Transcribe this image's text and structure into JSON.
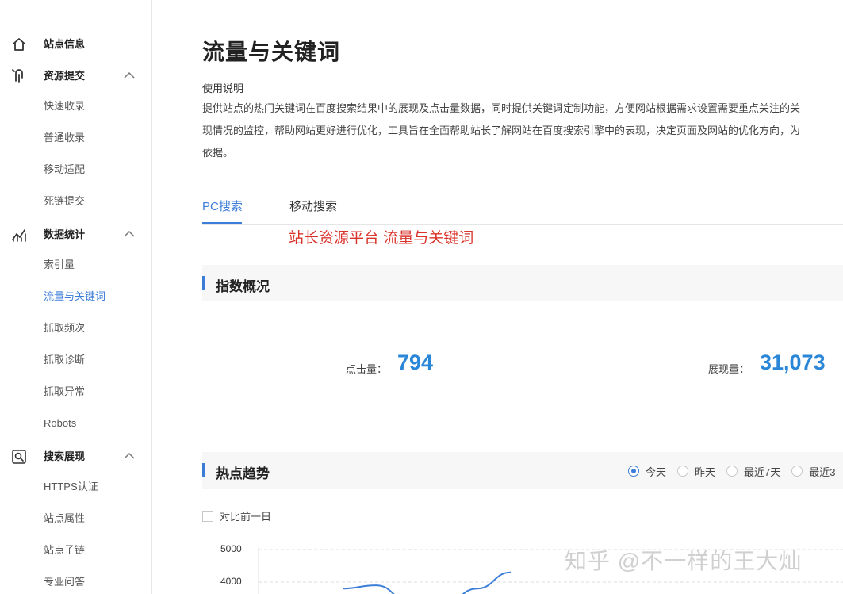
{
  "sidebar": {
    "groups": [
      {
        "label": "站点信息",
        "icon": "home-icon",
        "items": []
      },
      {
        "label": "资源提交",
        "icon": "submit-icon",
        "items": [
          "快速收录",
          "普通收录",
          "移动适配",
          "死链提交"
        ]
      },
      {
        "label": "数据统计",
        "icon": "stats-icon",
        "items": [
          "索引量",
          "流量与关键词",
          "抓取频次",
          "抓取诊断",
          "抓取异常",
          "Robots"
        ]
      },
      {
        "label": "搜索展现",
        "icon": "search-display-icon",
        "items": [
          "HTTPS认证",
          "站点属性",
          "站点子链",
          "专业问答"
        ]
      }
    ],
    "active_item": "流量与关键词"
  },
  "main": {
    "title": "流量与关键词",
    "usage": {
      "title": "使用说明",
      "lines": [
        "提供站点的热门关键词在百度搜索结果中的展现及点击量数据，同时提供关键词定制功能，方便网站根据需求设置需要重点关注的关",
        "现情况的监控，帮助网站更好进行优化，工具旨在全面帮助站长了解网站在百度搜索引擎中的表现，决定页面及网站的优化方向，为",
        "依据。"
      ]
    },
    "tabs": [
      {
        "label": "PC搜索",
        "active": true
      },
      {
        "label": "移动搜索",
        "active": false
      }
    ],
    "overlay_text": "站长资源平台  流量与关键词",
    "index_overview": {
      "title": "指数概况",
      "clicks_label": "点击量：",
      "clicks_value": "794",
      "impressions_label": "展现量：",
      "impressions_value": "31,073"
    },
    "hot_trend": {
      "title": "热点趋势",
      "ranges": [
        {
          "label": "今天",
          "checked": true
        },
        {
          "label": "昨天",
          "checked": false
        },
        {
          "label": "最近7天",
          "checked": false
        },
        {
          "label": "最近3",
          "checked": false
        }
      ],
      "compare_label": "对比前一日"
    },
    "watermark": "知乎 @不一样的王大灿"
  },
  "colors": {
    "accent": "#3c7dd8",
    "value_blue": "#2a86d6",
    "overlay_red": "#d9342b"
  },
  "chart_data": {
    "type": "line",
    "y_ticks": [
      "5000",
      "4000"
    ],
    "ylim": [
      0,
      5000
    ],
    "grid": true,
    "series": [
      {
        "values": [
          3800,
          3900,
          3400,
          3300,
          3800,
          4300
        ]
      }
    ]
  }
}
